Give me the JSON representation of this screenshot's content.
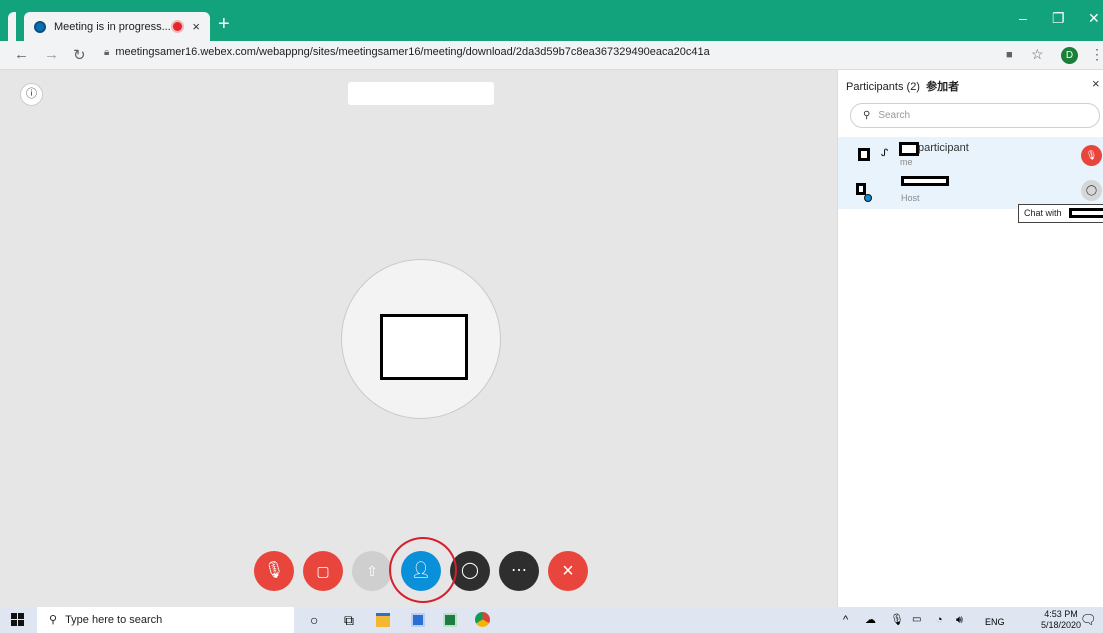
{
  "browser": {
    "tab_title": "Meeting is in progress...",
    "tab_close": "×",
    "new_tab": "+",
    "url": "meetingsamer16.webex.com/webappng/sites/meetingsamer16/meeting/download/2da3d59b7c8ea367329490eaca20c41a",
    "profile_initial": "D"
  },
  "participants_panel": {
    "title": "Participants (2)",
    "title_cjk": "参加者",
    "close": "×",
    "search_placeholder": "Search",
    "participants": [
      {
        "name": "participant",
        "role": "me",
        "status": "muted"
      },
      {
        "name": "",
        "role": "Host",
        "status": "chat"
      }
    ],
    "tooltip": "Chat with"
  },
  "controls": [
    {
      "name": "mute",
      "icon": "mic-off-icon",
      "color": "#e8453c"
    },
    {
      "name": "video",
      "icon": "video-off-icon",
      "color": "#e8453c"
    },
    {
      "name": "share",
      "icon": "share-icon",
      "color": "#cfcfcf"
    },
    {
      "name": "participants",
      "icon": "participants-icon",
      "color": "#0a8fd9"
    },
    {
      "name": "chat",
      "icon": "chat-icon",
      "color": "#2e2e2e"
    },
    {
      "name": "more",
      "icon": "more-icon",
      "color": "#2e2e2e"
    },
    {
      "name": "leave",
      "icon": "close-icon",
      "color": "#e8453c"
    }
  ],
  "taskbar": {
    "search_placeholder": "Type here to search",
    "language": "ENG",
    "time": "4:53 PM",
    "date": "5/18/2020"
  },
  "colors": {
    "tab_bar": "#12a37c",
    "stage": "#e6e6e6",
    "highlight_ring": "#d6202e"
  }
}
